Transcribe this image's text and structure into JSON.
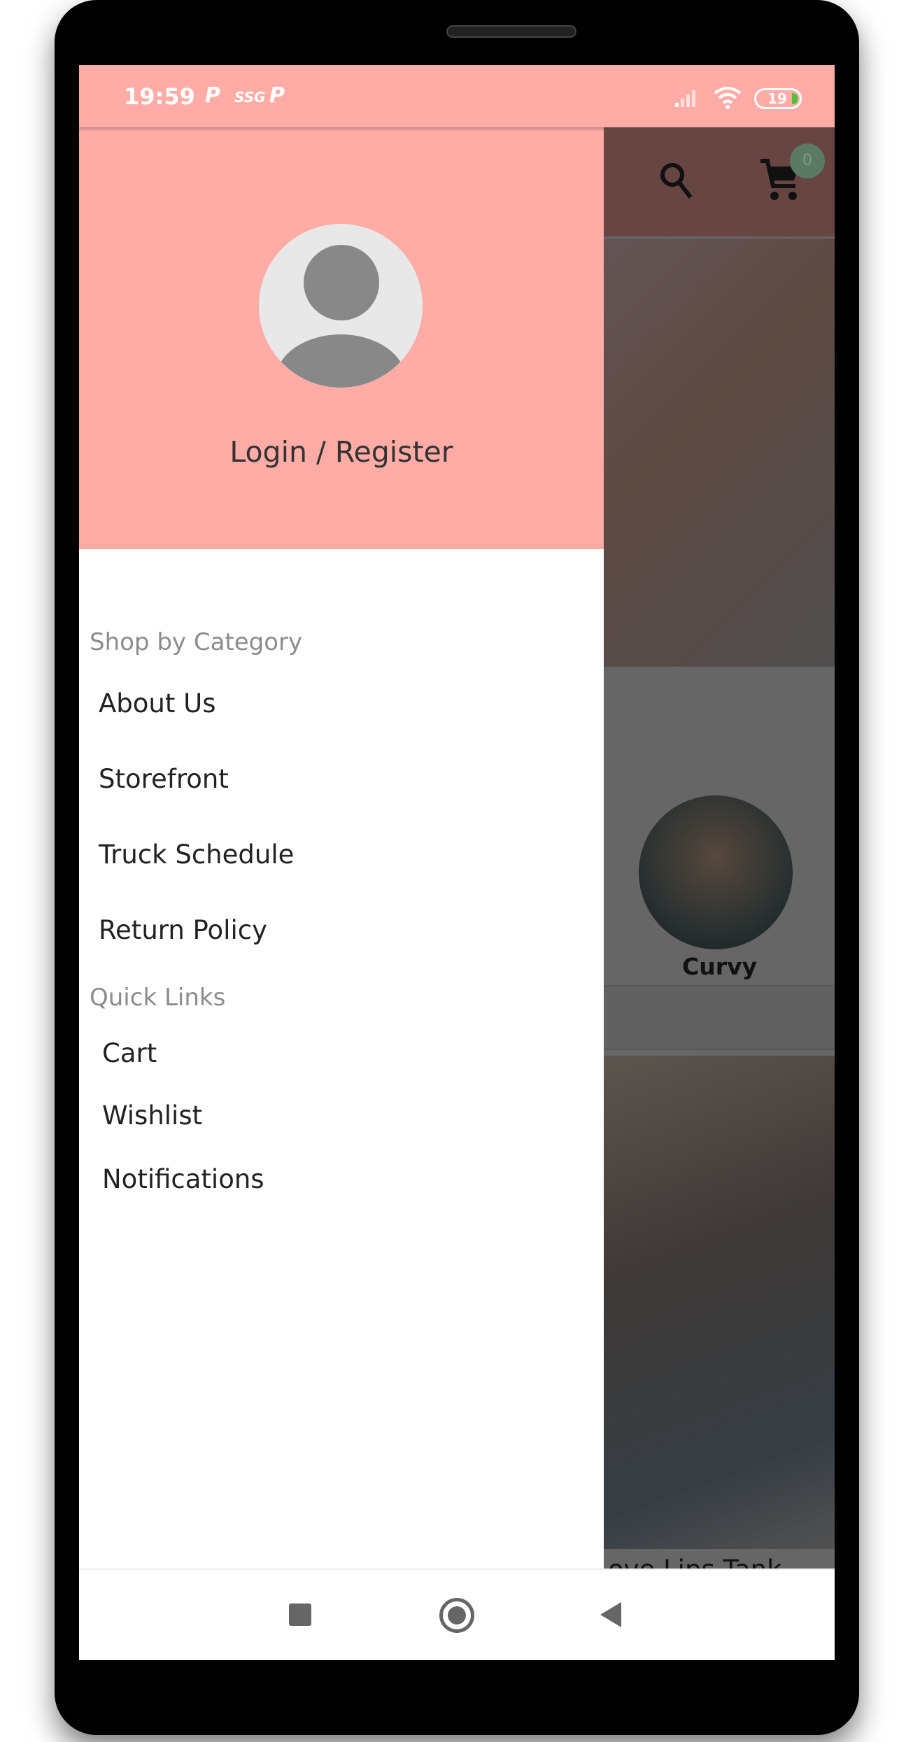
{
  "status_bar": {
    "time": "19:59",
    "icons": [
      "P",
      "SSG",
      "P"
    ],
    "battery": "19",
    "signal": "signal-icon",
    "wifi": "wifi-icon"
  },
  "app_bar": {
    "cart_badge": "0",
    "search_icon": "search-icon",
    "cart_icon": "cart-icon"
  },
  "background": {
    "category_label": "Curvy",
    "product_title": "ove Lips Tank"
  },
  "drawer": {
    "login_label": "Login / Register",
    "shop_section": "Shop by Category",
    "shop_items": [
      {
        "label": "About Us"
      },
      {
        "label": "Storefront"
      },
      {
        "label": "Truck Schedule"
      },
      {
        "label": "Return Policy"
      }
    ],
    "quick_section": "Quick Links",
    "quick_items": [
      {
        "label": "Cart"
      },
      {
        "label": "Wishlist"
      },
      {
        "label": "Notifications"
      }
    ]
  },
  "colors": {
    "accent": "#ffaca7"
  }
}
